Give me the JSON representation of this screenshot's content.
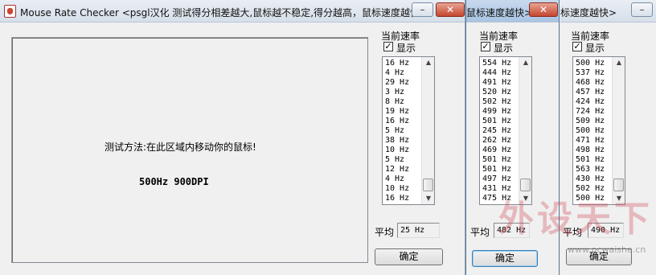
{
  "window_main": {
    "title": "Mouse Rate Checker <psgl汉化  测试得分相差越大,鼠标越不稳定,得分越高，鼠标速度越快>",
    "test_hint": "测试方法:在此区域内移动你的鼠标!",
    "test_result": "500Hz 900DPI",
    "panel_label": "当前速率",
    "show_label": "显示",
    "show_checked": true,
    "rates": [
      "16 Hz",
      "4 Hz",
      "29 Hz",
      "3 Hz",
      "8 Hz",
      "19 Hz",
      "16 Hz",
      "5 Hz",
      "38 Hz",
      "10 Hz",
      "5 Hz",
      "12 Hz",
      "4 Hz",
      "10 Hz",
      "16 Hz"
    ],
    "avg_label": "平均",
    "avg_value": "25 Hz",
    "ok_label": "确定",
    "minimize_glyph": "–",
    "close_glyph": "✕"
  },
  "window_second": {
    "title": "鼠标速度越快>",
    "panel_label": "当前速率",
    "show_label": "显示",
    "rates": [
      "554 Hz",
      "444 Hz",
      "491 Hz",
      "520 Hz",
      "502 Hz",
      "499 Hz",
      "501 Hz",
      "245 Hz",
      "262 Hz",
      "469 Hz",
      "501 Hz",
      "501 Hz",
      "497 Hz",
      "431 Hz",
      "475 Hz"
    ],
    "avg_label": "平均",
    "avg_value": "482 Hz",
    "ok_label": "确定",
    "close_glyph": "✕"
  },
  "window_third": {
    "title": "标速度越快>",
    "panel_label": "当前速率",
    "show_label": "显示",
    "rates": [
      "500 Hz",
      "537 Hz",
      "468 Hz",
      "457 Hz",
      "424 Hz",
      "724 Hz",
      "509 Hz",
      "500 Hz",
      "471 Hz",
      "498 Hz",
      "501 Hz",
      "563 Hz",
      "430 Hz",
      "502 Hz",
      "500 Hz"
    ],
    "avg_label": "平均",
    "avg_value": "490 Hz",
    "ok_label": "确定",
    "minimize_glyph": "–"
  },
  "watermark": {
    "logo_text": "外设天下",
    "url": "www.pcwaishe.cn"
  },
  "colors": {
    "window_bg": "#f0f0f0",
    "titlebar_active": "#a9c4e3",
    "close_red": "#c4462f"
  },
  "icons": {
    "app": "mouse-app-icon",
    "up": "scroll-up-arrow-icon",
    "down": "scroll-down-arrow-icon",
    "check": "checkmark-icon"
  }
}
